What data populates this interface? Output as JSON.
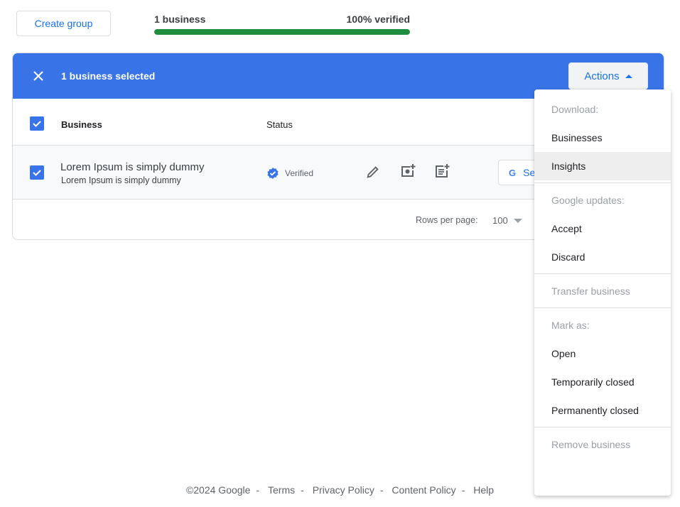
{
  "toolbar": {
    "create_group": "Create group"
  },
  "summary": {
    "count": "1 business",
    "verified": "100% verified",
    "progress_percent": 100,
    "progress_color": "#1e8e3e"
  },
  "selection": {
    "text": "1 business selected",
    "actions": "Actions",
    "bar_color": "#3874e8"
  },
  "table": {
    "headers": {
      "business": "Business",
      "status": "Status"
    },
    "rows": [
      {
        "name": "Lorem Ipsum is simply dummy",
        "address": "Lorem Ipsum is simply dummy",
        "status": "Verified",
        "checked": true,
        "button": "Se"
      }
    ],
    "rows_per_page_label": "Rows per page:",
    "rows_per_page": "100"
  },
  "menu": {
    "download_header": "Download:",
    "businesses": "Businesses",
    "insights": "Insights",
    "updates_header": "Google updates:",
    "accept": "Accept",
    "discard": "Discard",
    "transfer": "Transfer business",
    "mark_header": "Mark as:",
    "open": "Open",
    "temp_closed": "Temporarily closed",
    "perm_closed": "Permanently closed",
    "remove": "Remove business"
  },
  "footer": {
    "copyright": "©2024 Google",
    "sep": "-",
    "terms": "Terms",
    "privacy": "Privacy Policy",
    "content": "Content Policy",
    "help": "Help"
  }
}
